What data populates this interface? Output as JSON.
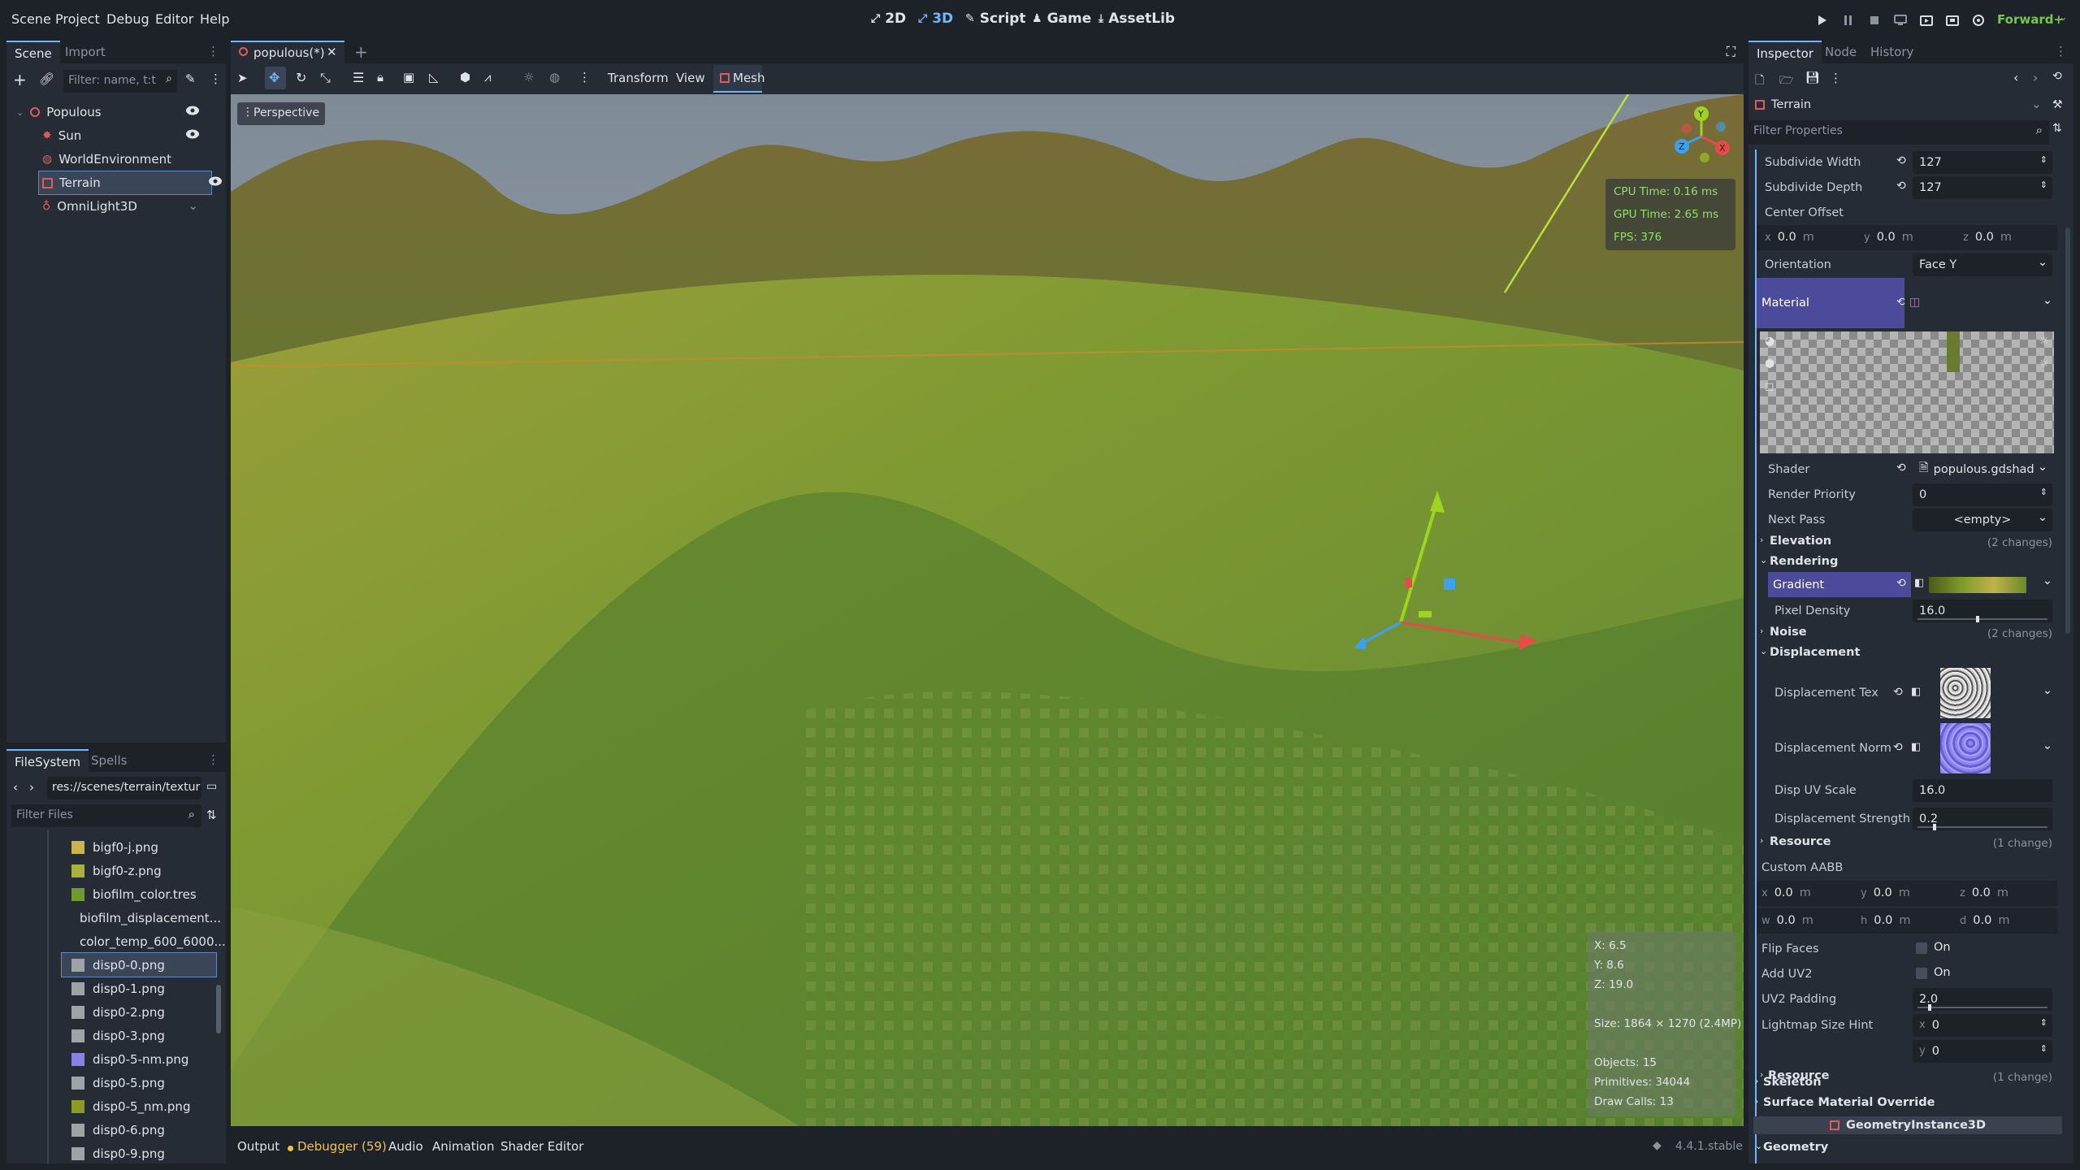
{
  "menu": [
    "Scene",
    "Project",
    "Debug",
    "Editor",
    "Help"
  ],
  "workspaces": [
    {
      "label": "2D",
      "active": false
    },
    {
      "label": "3D",
      "active": true
    },
    {
      "label": "Script",
      "active": false
    },
    {
      "label": "Game",
      "active": false
    },
    {
      "label": "AssetLib",
      "active": false
    }
  ],
  "renderer": "Forward+",
  "scene_panel": {
    "tabs": [
      "Scene",
      "Import"
    ],
    "filter_placeholder": "Filter: name, t:t",
    "nodes": [
      {
        "name": "Populous",
        "icon": "node3d-icon",
        "depth": 0
      },
      {
        "name": "Sun",
        "icon": "sun-icon",
        "depth": 1
      },
      {
        "name": "WorldEnvironment",
        "icon": "globe-icon",
        "depth": 1
      },
      {
        "name": "Terrain",
        "icon": "mesh-icon",
        "depth": 1
      },
      {
        "name": "OmniLight3D",
        "icon": "light-icon",
        "depth": 1
      }
    ]
  },
  "filesystem": {
    "tabs": [
      "FileSystem",
      "Spells"
    ],
    "path": "res://scenes/terrain/textur",
    "filter_placeholder": "Filter Files",
    "files": [
      {
        "name": "bigf0-j.png",
        "color": "#c9b54a"
      },
      {
        "name": "bigf0-z.png",
        "color": "#a7b13b"
      },
      {
        "name": "biofilm_color.tres",
        "color": "#6f9a2f"
      },
      {
        "name": "biofilm_displacement...",
        "color": "#bdbdbd"
      },
      {
        "name": "color_temp_600_6000...",
        "color": "#1f2a9a"
      },
      {
        "name": "disp0-0.png",
        "color": "#9ea3a8"
      },
      {
        "name": "disp0-1.png",
        "color": "#9ea3a8"
      },
      {
        "name": "disp0-2.png",
        "color": "#9ea3a8"
      },
      {
        "name": "disp0-3.png",
        "color": "#9ea3a8"
      },
      {
        "name": "disp0-5-nm.png",
        "color": "#8a80e8"
      },
      {
        "name": "disp0-5.png",
        "color": "#9ea3a8"
      },
      {
        "name": "disp0-5_nm.png",
        "color": "#8a9a22"
      },
      {
        "name": "disp0-6.png",
        "color": "#9ea3a8"
      },
      {
        "name": "disp0-9.png",
        "color": "#9ea3a8"
      }
    ]
  },
  "editor": {
    "scene_tab": "populous(*)",
    "toolbar_menus": [
      "Transform",
      "View",
      "Mesh"
    ],
    "perspective": "Perspective",
    "stats": [
      "CPU Time: 0.16 ms",
      "GPU Time: 2.65 ms",
      "FPS: 376"
    ],
    "info": [
      "X: 6.5",
      "Y: 8.6",
      "Z: 19.0",
      "Size: 1864 × 1270 (2.4MP)",
      "Objects: 15",
      "Primitives: 34044",
      "Draw Calls: 13"
    ]
  },
  "bottom_tabs": [
    "Output",
    "Debugger (59)",
    "Audio",
    "Animation",
    "Shader Editor"
  ],
  "version": "4.4.1.stable",
  "inspector": {
    "tabs": [
      "Inspector",
      "Node",
      "History"
    ],
    "object": "Terrain",
    "filter_placeholder": "Filter Properties",
    "subdivide_width": {
      "label": "Subdivide Width",
      "value": "127"
    },
    "subdivide_depth": {
      "label": "Subdivide Depth",
      "value": "127"
    },
    "center_offset": {
      "label": "Center Offset",
      "x": "0.0",
      "y": "0.0",
      "z": "0.0",
      "unit": "m"
    },
    "orientation": {
      "label": "Orientation",
      "value": "Face Y"
    },
    "material": {
      "label": "Material"
    },
    "shader": {
      "label": "Shader",
      "value": "populous.gdshad"
    },
    "render_priority": {
      "label": "Render Priority",
      "value": "0"
    },
    "next_pass": {
      "label": "Next Pass",
      "value": "<empty>"
    },
    "elevation": {
      "label": "Elevation",
      "changes": "(2 changes)"
    },
    "rendering": {
      "label": "Rendering"
    },
    "gradient": {
      "label": "Gradient"
    },
    "pixel_density": {
      "label": "Pixel Density",
      "value": "16.0"
    },
    "noise": {
      "label": "Noise",
      "changes": "(2 changes)"
    },
    "displacement": {
      "label": "Displacement"
    },
    "displacement_tex": {
      "label": "Displacement Tex"
    },
    "displacement_norm": {
      "label": "Displacement Norm"
    },
    "disp_uv_scale": {
      "label": "Disp UV Scale",
      "value": "16.0"
    },
    "displacement_strength": {
      "label": "Displacement Strength",
      "value": "0.2"
    },
    "resource1": {
      "label": "Resource",
      "changes": "(1 change)"
    },
    "custom_aabb": {
      "label": "Custom AABB",
      "x": "0.0",
      "y": "0.0",
      "z": "0.0",
      "w": "0.0",
      "h": "0.0",
      "d": "0.0",
      "unit": "m"
    },
    "flip_faces": {
      "label": "Flip Faces",
      "value": "On"
    },
    "add_uv2": {
      "label": "Add UV2",
      "value": "On"
    },
    "uv2_padding": {
      "label": "UV2 Padding",
      "value": "2.0"
    },
    "lightmap_size_hint": {
      "label": "Lightmap Size Hint",
      "x": "0",
      "y": "0"
    },
    "resource2": {
      "label": "Resource",
      "changes": "(1 change)"
    },
    "skeleton": "Skeleton",
    "surface_material_override": "Surface Material Override",
    "class_header": "GeometryInstance3D",
    "geometry": "Geometry"
  }
}
